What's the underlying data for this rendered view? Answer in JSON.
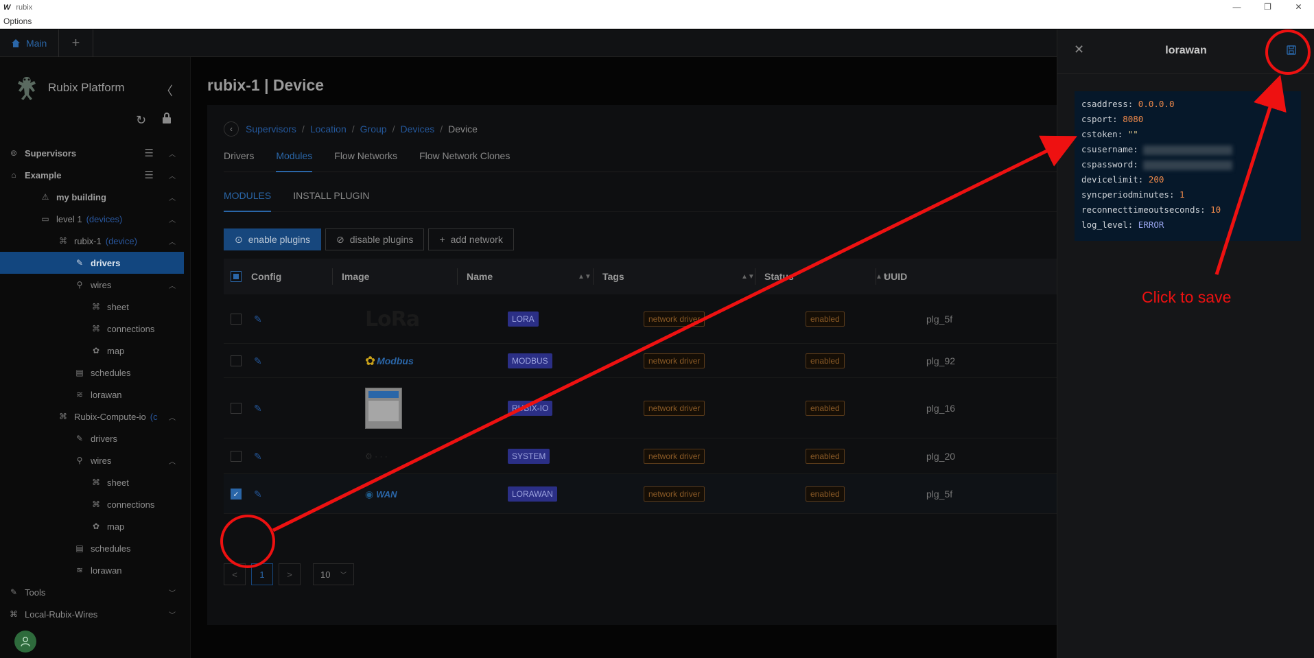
{
  "window": {
    "logo": "W",
    "title": "rubix",
    "menu": "Options",
    "minimize": "—",
    "restore": "❐",
    "close": "✕"
  },
  "tabs": {
    "main_label": "Main",
    "add_label": "+"
  },
  "sidebar": {
    "brand": "Rubix Platform",
    "collapse": "〈",
    "refresh": "↻",
    "lock": "🔒",
    "items": [
      {
        "label": "Supervisors",
        "icon": "⊚",
        "indent": 12,
        "bold": true,
        "chev": "︿",
        "menu": "☰"
      },
      {
        "label": "Example",
        "icon": "⌂",
        "indent": 12,
        "bold": true,
        "chev": "︿",
        "menu": "☰"
      },
      {
        "label": "my building",
        "icon": "⚠",
        "indent": 58,
        "bold": true,
        "chev": "︿"
      },
      {
        "label": "level 1",
        "icon": "▭",
        "indent": 58,
        "tag": "(devices)",
        "chev": "︿"
      },
      {
        "label": "rubix-1",
        "icon": "⌘",
        "indent": 84,
        "tag": "(device)",
        "chev": "︿"
      },
      {
        "label": "drivers",
        "icon": "✎",
        "indent": 108,
        "active": true
      },
      {
        "label": "wires",
        "icon": "⚲",
        "indent": 108,
        "chev": "︿"
      },
      {
        "label": "sheet",
        "icon": "⌘",
        "indent": 132
      },
      {
        "label": "connections",
        "icon": "⌘",
        "indent": 132
      },
      {
        "label": "map",
        "icon": "✿",
        "indent": 132
      },
      {
        "label": "schedules",
        "icon": "▤",
        "indent": 108
      },
      {
        "label": "lorawan",
        "icon": "≋",
        "indent": 108
      },
      {
        "label": "Rubix-Compute-io",
        "icon": "⌘",
        "indent": 84,
        "tag": "(c",
        "chev": "︿"
      },
      {
        "label": "drivers",
        "icon": "✎",
        "indent": 108
      },
      {
        "label": "wires",
        "icon": "⚲",
        "indent": 108,
        "chev": "︿"
      },
      {
        "label": "sheet",
        "icon": "⌘",
        "indent": 132
      },
      {
        "label": "connections",
        "icon": "⌘",
        "indent": 132
      },
      {
        "label": "map",
        "icon": "✿",
        "indent": 132
      },
      {
        "label": "schedules",
        "icon": "▤",
        "indent": 108
      },
      {
        "label": "lorawan",
        "icon": "≋",
        "indent": 108
      },
      {
        "label": "Tools",
        "icon": "✎",
        "indent": 12,
        "chev": "﹀"
      },
      {
        "label": "Local-Rubix-Wires",
        "icon": "⌘",
        "indent": 12,
        "chev": "﹀"
      }
    ]
  },
  "page": {
    "title": "rubix-1 | Device",
    "breadcrumb": [
      "Supervisors",
      "Location",
      "Group",
      "Devices",
      "Device"
    ],
    "tabs": [
      "Drivers",
      "Modules",
      "Flow Networks",
      "Flow Network Clones"
    ],
    "active_tab": "Modules",
    "subtabs": [
      "MODULES",
      "INSTALL PLUGIN"
    ],
    "active_subtab": "MODULES",
    "actions": {
      "enable": "enable plugins",
      "disable": "disable plugins",
      "add": "add network"
    },
    "columns": [
      "Config",
      "Image",
      "Name",
      "Tags",
      "Status",
      "UUID"
    ],
    "rows": [
      {
        "logo": "lora",
        "logo_text": "LoRa",
        "name": "LORA",
        "tag": "network driver",
        "status": "enabled",
        "uuid": "plg_5f",
        "checked": false
      },
      {
        "logo": "modbus",
        "logo_text": "Modbus",
        "name": "MODBUS",
        "tag": "network driver",
        "status": "enabled",
        "uuid": "plg_92",
        "checked": false
      },
      {
        "logo": "rubixio",
        "logo_text": "",
        "name": "RUBIX-IO",
        "tag": "network driver",
        "status": "enabled",
        "uuid": "plg_16",
        "checked": false
      },
      {
        "logo": "system",
        "logo_text": "",
        "name": "SYSTEM",
        "tag": "network driver",
        "status": "enabled",
        "uuid": "plg_20",
        "checked": false
      },
      {
        "logo": "wan",
        "logo_text": "WAN",
        "name": "LORAWAN",
        "tag": "network driver",
        "status": "enabled",
        "uuid": "plg_5f",
        "checked": true
      }
    ],
    "pager": {
      "prev": "<",
      "page": "1",
      "next": ">",
      "size": "10"
    }
  },
  "drawer": {
    "title": "lorawan",
    "close": "✕",
    "config": [
      {
        "key": "csaddress",
        "value": "0.0.0.0",
        "kind": "str"
      },
      {
        "key": "csport",
        "value": "8080",
        "kind": "num"
      },
      {
        "key": "cstoken",
        "value": "\"\"",
        "kind": "q"
      },
      {
        "key": "csusername",
        "value": "",
        "kind": "blur"
      },
      {
        "key": "cspassword",
        "value": "",
        "kind": "blur"
      },
      {
        "key": "devicelimit",
        "value": "200",
        "kind": "num"
      },
      {
        "key": "syncperiodminutes",
        "value": "1",
        "kind": "num"
      },
      {
        "key": "reconnecttimeoutseconds",
        "value": "10",
        "kind": "num"
      },
      {
        "key": "log_level",
        "value": "ERROR",
        "kind": "enum"
      }
    ]
  },
  "annotation": {
    "text": "Click to save",
    "color": "#ee1111"
  }
}
